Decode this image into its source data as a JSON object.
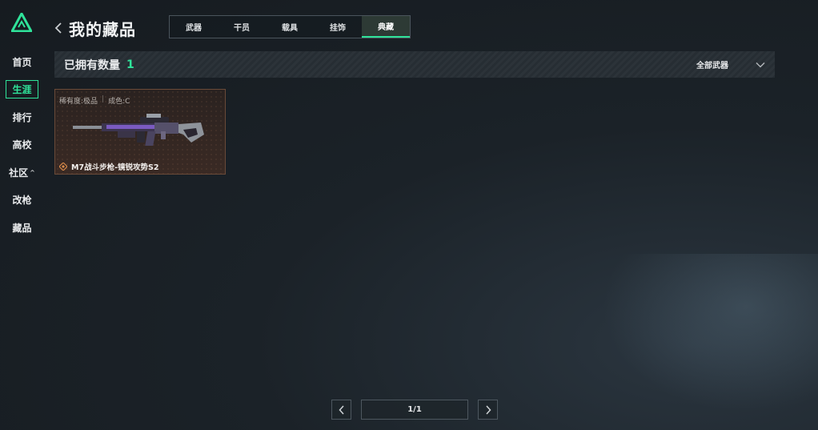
{
  "sidebar": {
    "logo_icon": "triangle-logo-icon",
    "items": [
      {
        "label": "首页",
        "active": false
      },
      {
        "label": "生涯",
        "active": true
      },
      {
        "label": "排行",
        "active": false
      },
      {
        "label": "高校",
        "active": false
      },
      {
        "label": "社区",
        "active": false,
        "caret": "^"
      },
      {
        "label": "改枪",
        "active": false
      },
      {
        "label": "藏品",
        "active": false
      }
    ]
  },
  "header": {
    "title": "我的藏品",
    "back_icon": "chevron-left-icon"
  },
  "tabs": [
    {
      "label": "武器",
      "active": false
    },
    {
      "label": "干员",
      "active": false
    },
    {
      "label": "载具",
      "active": false
    },
    {
      "label": "挂饰",
      "active": false
    },
    {
      "label": "典藏",
      "active": true
    }
  ],
  "summary": {
    "owned_label": "已拥有数量",
    "owned_count": "1",
    "filter_label": "全部武器",
    "filter_icon": "chevron-down-icon"
  },
  "items": [
    {
      "rarity": "稀有度:极品",
      "condition": "成色:C",
      "name": "M7战斗步枪-镜锐攻势S2",
      "rarity_icon": "diamond-gem-icon"
    }
  ],
  "pagination": {
    "page": "1/1",
    "prev_icon": "chevron-left-icon",
    "next_icon": "chevron-right-icon"
  },
  "colors": {
    "accent": "#2fe39a",
    "card_border": "#6a4a38",
    "rarity": "#d88a4a"
  }
}
